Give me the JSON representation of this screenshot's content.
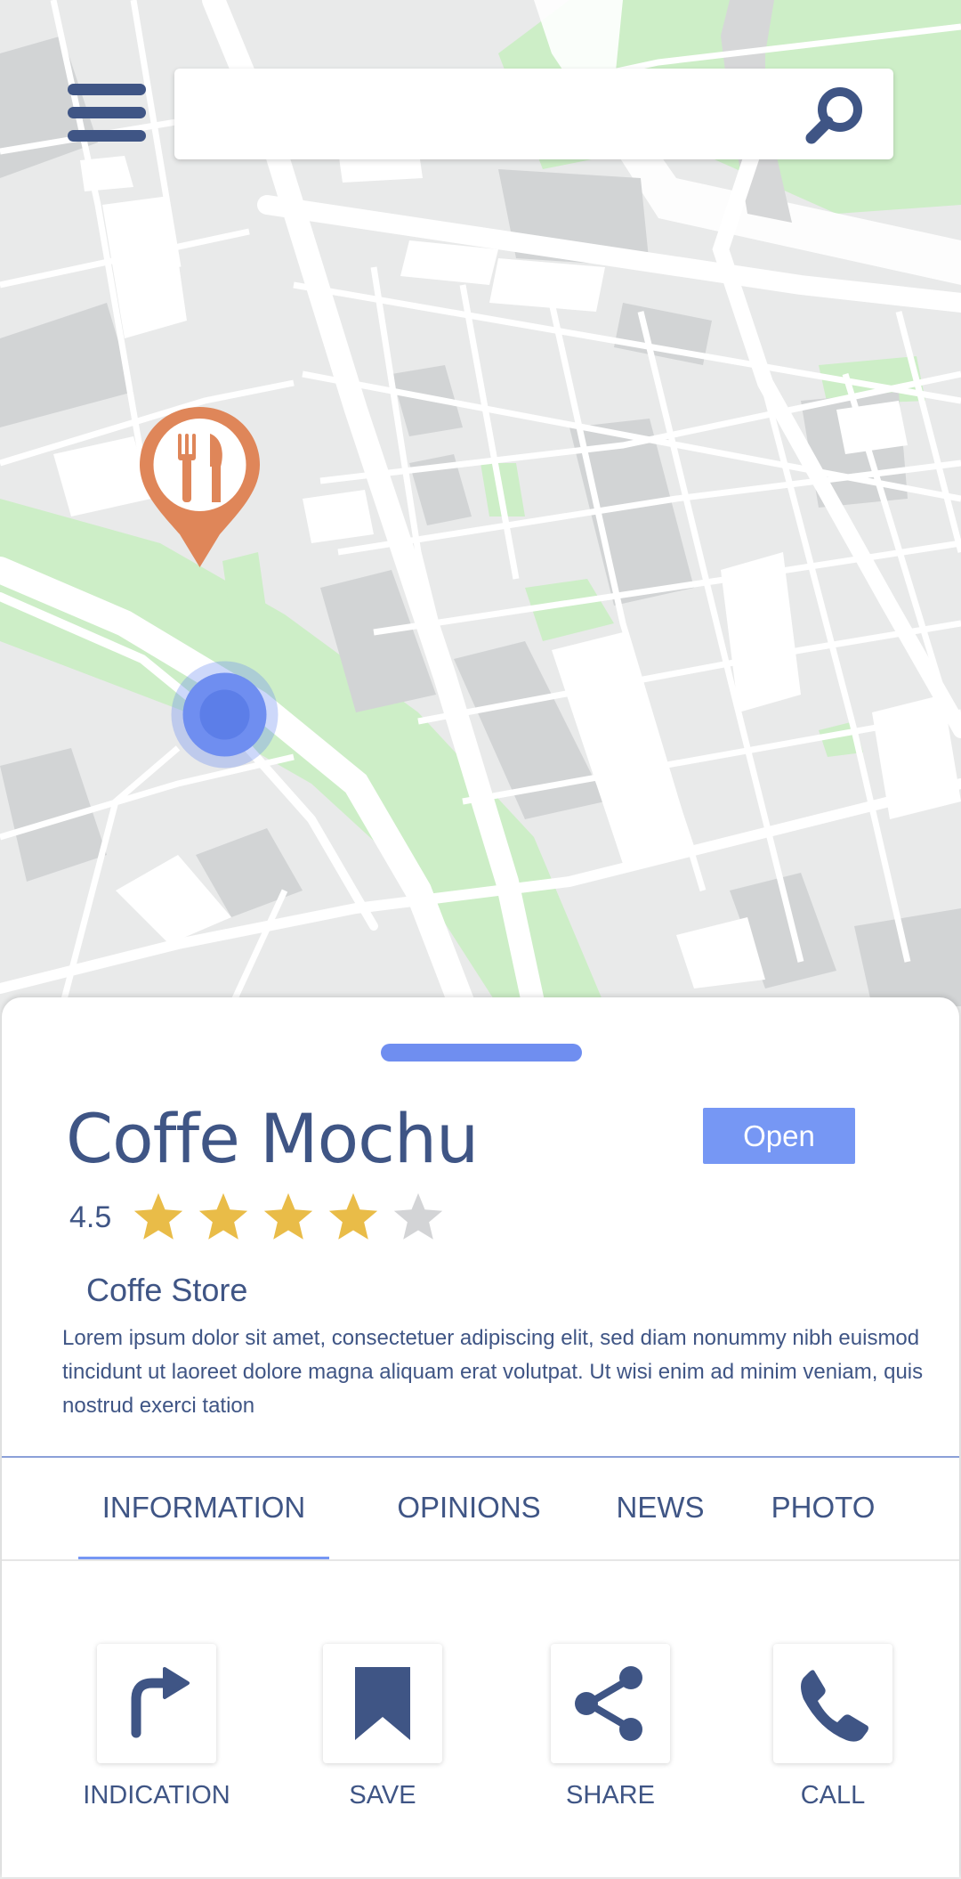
{
  "search": {
    "placeholder": "",
    "value": "",
    "icon": "search-icon"
  },
  "map": {
    "poi_marker_icon": "restaurant-icon",
    "poi_marker_color": "#df8659",
    "user_location_color": "#6f8ef0"
  },
  "place": {
    "title": "Coffe Mochu",
    "status": "Open",
    "rating": {
      "value": "4.5",
      "stars_filled": 4,
      "stars_total": 5
    },
    "category": "Coffe Store",
    "description": "Lorem ipsum dolor sit amet, consectetuer adipiscing elit, sed diam nonummy nibh euismod tincidunt ut laoreet dolore magna aliquam erat volutpat. Ut wisi enim ad minim veniam, quis nostrud exerci tation"
  },
  "tabs": [
    {
      "label": "INFORMATION",
      "active": true
    },
    {
      "label": "OPINIONS",
      "active": false
    },
    {
      "label": "NEWS",
      "active": false
    },
    {
      "label": "PHOTO",
      "active": false
    }
  ],
  "actions": [
    {
      "label": "INDICATION",
      "icon": "turn-right-arrow-icon"
    },
    {
      "label": "SAVE",
      "icon": "bookmark-icon"
    },
    {
      "label": "SHARE",
      "icon": "share-icon"
    },
    {
      "label": "CALL",
      "icon": "phone-icon"
    }
  ],
  "colors": {
    "primary_text": "#3f5585",
    "accent": "#7697f4",
    "star_filled": "#e9bc48",
    "star_empty": "#d3d4d6",
    "park_green": "#cdeec7"
  }
}
